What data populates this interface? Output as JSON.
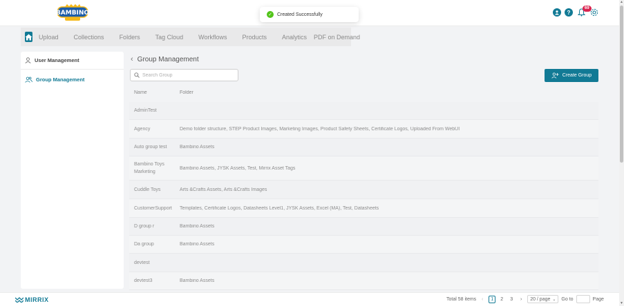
{
  "header": {
    "logo_text": "BAMBINO",
    "notification_count": "69"
  },
  "toast": {
    "message": "Created Successfully"
  },
  "nav": {
    "items": [
      "Upload",
      "Collections",
      "Folders",
      "Tag Cloud",
      "Workflows",
      "Products",
      "Analytics",
      "PDF on Demand"
    ]
  },
  "sidebar": {
    "items": [
      {
        "label": "User Management"
      },
      {
        "label": "Group Management"
      }
    ]
  },
  "page": {
    "title": "Group Management",
    "search_placeholder": "Search Group",
    "create_label": "Create Group"
  },
  "table": {
    "columns": [
      "Name",
      "Folder"
    ],
    "rows": [
      {
        "name": "AdminTest",
        "folder": ""
      },
      {
        "name": "Agency",
        "folder": "Demo folder structure, STEP Product Images, Marketing Images, Product Safety Sheets, Certificate Logos, Uploaded From WebUI"
      },
      {
        "name": "Auto group test",
        "folder": "Bambino Assets"
      },
      {
        "name": "Bambino Toys Marketing",
        "folder": "Bambino Assets, JYSK Assets, Test, Mirrix Asset Tags"
      },
      {
        "name": "Cuddle Toys",
        "folder": "Arts &Crafts Assets, Arts &Crafts Images"
      },
      {
        "name": "CustomerSupport",
        "folder": "Templates, Certificate Logos, Datasheets Level1, JYSK Assets, Excel (MA), Test, Datasheets"
      },
      {
        "name": "D group r",
        "folder": "Bambino Assets"
      },
      {
        "name": "Da group",
        "folder": "Bambino Assets"
      },
      {
        "name": "devtest",
        "folder": ""
      },
      {
        "name": "devtest3",
        "folder": "Bambino Assets"
      }
    ]
  },
  "footer": {
    "brand": "MIRRIX",
    "total": "Total 58 items",
    "pages": [
      "1",
      "2",
      "3"
    ],
    "page_size": "20 / page",
    "goto_label": "Go to",
    "page_label": "Page"
  },
  "colors": {
    "accent": "#127a95",
    "success": "#52c41a",
    "badge": "#d92550"
  }
}
